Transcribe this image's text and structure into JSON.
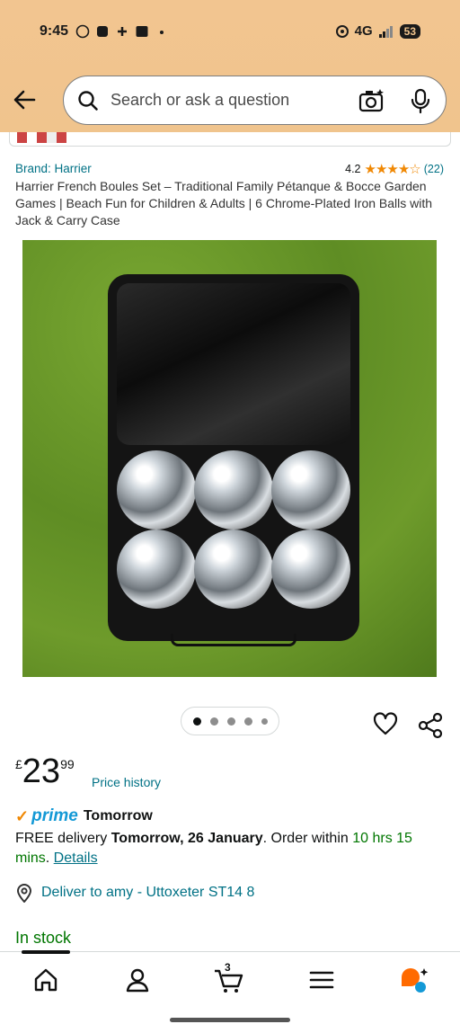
{
  "status_bar": {
    "time": "9:45",
    "network": "4G",
    "battery": "53"
  },
  "search": {
    "placeholder": "Search or ask a question"
  },
  "product": {
    "brand": "Brand: Harrier",
    "rating": "4.2",
    "rating_stars": 4.2,
    "review_count": "(22)",
    "title": "Harrier French Boules Set – Traditional Family Pétanque & Bocce Garden Games | Beach Fun for Children & Adults | 6 Chrome-Plated Iron Balls with Jack & Carry Case"
  },
  "carousel": {
    "image_count": 5,
    "active_index": 0
  },
  "price": {
    "currency": "£",
    "whole": "23",
    "fraction": "99",
    "history_link": "Price history"
  },
  "prime": {
    "label": "prime",
    "when": "Tomorrow"
  },
  "delivery": {
    "prefix": "FREE delivery ",
    "date": "Tomorrow, 26 January",
    "order_within": ". Order within ",
    "countdown": "10 hrs 15 mins",
    "sep": ". ",
    "details_link": "Details"
  },
  "deliver_to": "Deliver to amy - Uttoxeter ST14 8",
  "stock": "In stock",
  "nav": {
    "cart_count": "3"
  },
  "colors": {
    "header_bg": "#f0c48d",
    "link": "#007185",
    "in_stock": "#007600",
    "star": "#f08804",
    "prime_blue": "#1399d6"
  }
}
